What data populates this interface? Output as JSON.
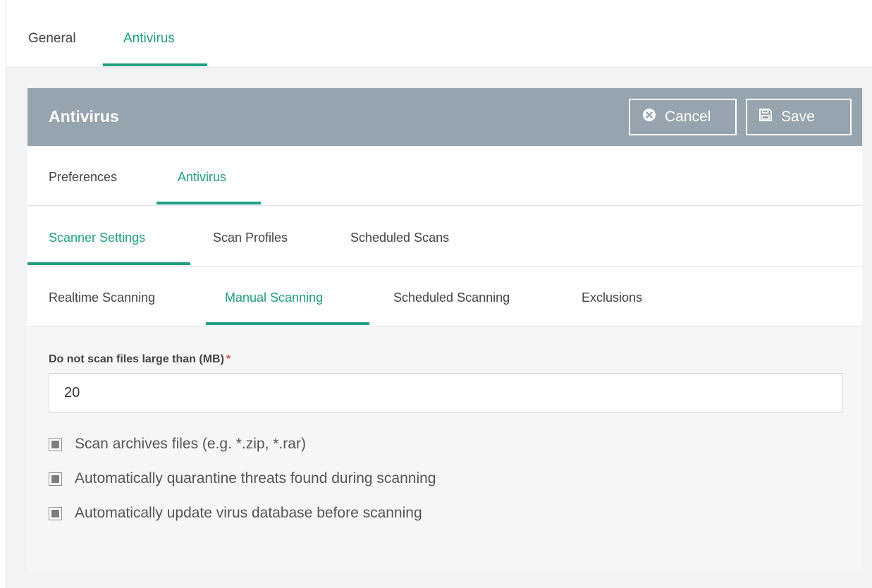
{
  "top_tabs": [
    {
      "label": "General",
      "active": false
    },
    {
      "label": "Antivirus",
      "active": true
    }
  ],
  "panel": {
    "title": "Antivirus",
    "cancel_label": "Cancel",
    "save_label": "Save",
    "cancel_icon": "x-circle-icon",
    "save_icon": "floppy-disk-icon",
    "header_color": "#95a4ae"
  },
  "sub_tabs": [
    {
      "label": "Preferences",
      "active": false
    },
    {
      "label": "Antivirus",
      "active": true
    }
  ],
  "scanner_tabs": [
    {
      "label": "Scanner Settings",
      "active": true
    },
    {
      "label": "Scan Profiles",
      "active": false
    },
    {
      "label": "Scheduled Scans",
      "active": false
    }
  ],
  "scan_tabs": [
    {
      "label": "Realtime Scanning",
      "active": false
    },
    {
      "label": "Manual Scanning",
      "active": true
    },
    {
      "label": "Scheduled Scanning",
      "active": false
    },
    {
      "label": "Exclusions",
      "active": false
    }
  ],
  "form": {
    "max_size_label": "Do not scan files large than (MB)",
    "required_marker": "*",
    "max_size_value": "20",
    "checkboxes": [
      {
        "label": "Scan archives files (e.g. *.zip, *.rar)",
        "checked": true
      },
      {
        "label": "Automatically quarantine threats found during scanning",
        "checked": true
      },
      {
        "label": "Automatically update virus database before scanning",
        "checked": true
      }
    ]
  },
  "colors": {
    "accent": "#1f9e82",
    "required": "#d9534f"
  }
}
